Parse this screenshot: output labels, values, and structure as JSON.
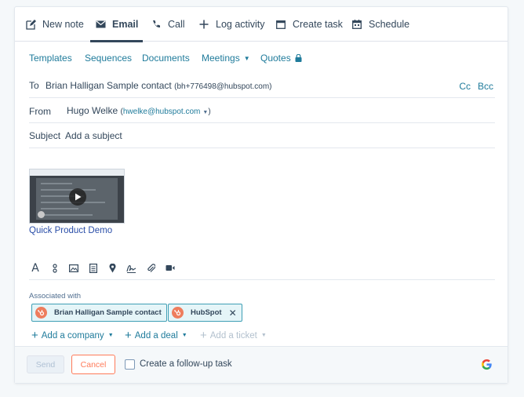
{
  "tabs": [
    {
      "label": "New note",
      "icon": "pencil-icon"
    },
    {
      "label": "Email",
      "icon": "envelope-icon",
      "active": true
    },
    {
      "label": "Call",
      "icon": "phone-icon"
    },
    {
      "label": "Log activity",
      "icon": "plus-icon"
    },
    {
      "label": "Create task",
      "icon": "task-icon"
    },
    {
      "label": "Schedule",
      "icon": "calendar-icon"
    }
  ],
  "toolbar": {
    "templates": "Templates",
    "sequences": "Sequences",
    "documents": "Documents",
    "meetings": "Meetings",
    "quotes": "Quotes"
  },
  "email": {
    "to_label": "To",
    "to_name": "Brian Halligan Sample contact",
    "to_address": "(bh+776498@hubspot.com)",
    "cc": "Cc",
    "bcc": "Bcc",
    "from_label": "From",
    "from_name": "Hugo Welke",
    "from_address_open": "(",
    "from_address": "hwelke@hubspot.com",
    "from_address_close": ")",
    "subject_label": "Subject",
    "subject_placeholder": "Add a subject"
  },
  "body": {
    "video_link": "Quick Product Demo"
  },
  "associations": {
    "label": "Associated with",
    "chips": [
      "Brian Halligan Sample contact",
      "HubSpot"
    ],
    "add_company": "Add a company",
    "add_deal": "Add a deal",
    "add_ticket": "Add a ticket"
  },
  "footer": {
    "send": "Send",
    "cancel": "Cancel",
    "followup": "Create a follow-up task"
  },
  "colors": {
    "link": "#1f7b9b",
    "accent": "#ff7a59",
    "chip_border": "#3f9fb5"
  }
}
